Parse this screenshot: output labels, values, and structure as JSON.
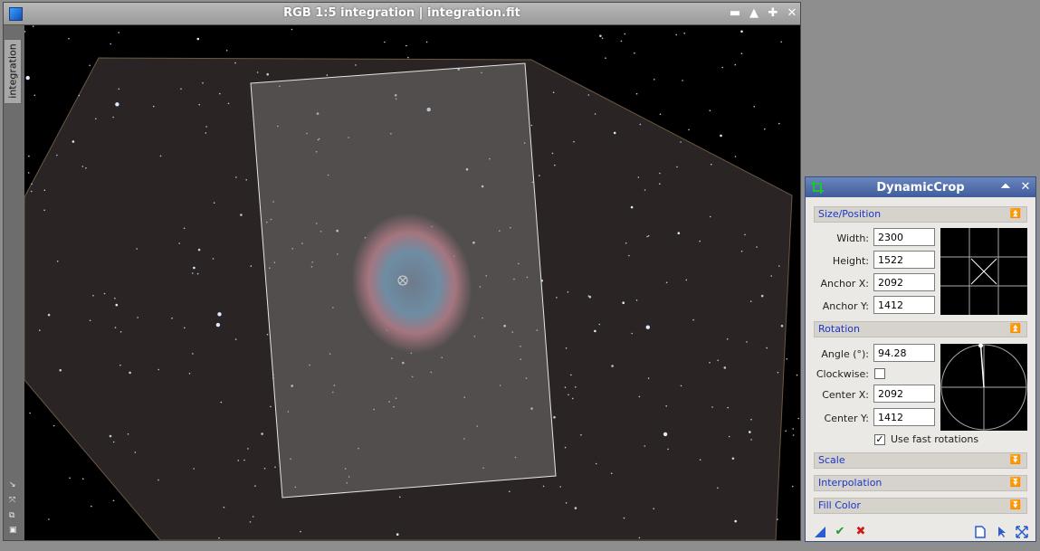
{
  "window": {
    "title": "RGB 1:5 integration | integration.fit",
    "side_tab": "integration",
    "buttons": {
      "minimize": "▬",
      "shade": "▲",
      "maximize": "✚",
      "close": "✕"
    }
  },
  "dynamic_crop": {
    "title": "DynamicCrop",
    "size_position": {
      "header": "Size/Position",
      "width_label": "Width:",
      "width": "2300",
      "height_label": "Height:",
      "height": "1522",
      "anchor_x_label": "Anchor X:",
      "anchor_x": "2092",
      "anchor_y_label": "Anchor Y:",
      "anchor_y": "1412"
    },
    "rotation": {
      "header": "Rotation",
      "angle_label": "Angle (°):",
      "angle": "94.28",
      "clockwise_label": "Clockwise:",
      "clockwise": false,
      "center_x_label": "Center X:",
      "center_x": "2092",
      "center_y_label": "Center Y:",
      "center_y": "1412",
      "fast_rotations_label": "Use fast rotations",
      "fast_rotations": true
    },
    "collapsed_sections": [
      "Scale",
      "Interpolation",
      "Fill Color"
    ],
    "icons": {
      "crop": "crop-icon",
      "new_instance": "triangle-icon",
      "execute": "check-icon",
      "cancel": "x-icon",
      "reset": "page-icon",
      "edit": "pointer-icon",
      "zoom": "arrows-icon"
    },
    "colors": {
      "titlebar": "#4a67a7",
      "section_text": "#1a36c9",
      "check_green": "#1d9a2b",
      "cancel_red": "#d01818"
    }
  }
}
